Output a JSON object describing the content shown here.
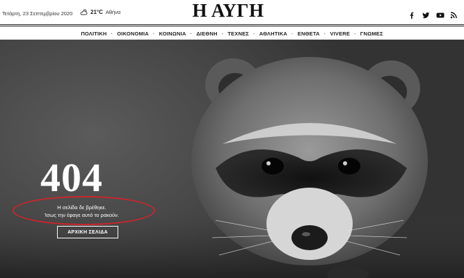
{
  "header": {
    "date": "Τετάρτη, 23 Σεπτεμβρίου 2020",
    "weather": {
      "temperature": "21°C",
      "city": "Αθήνα",
      "icon": "cloud-sun-icon"
    },
    "logo_text": "Η ΑΥΓΗ",
    "social": [
      {
        "name": "facebook-icon"
      },
      {
        "name": "twitter-icon"
      },
      {
        "name": "youtube-icon"
      },
      {
        "name": "rss-icon"
      }
    ]
  },
  "nav": {
    "items": [
      {
        "label": "ΠΟΛΙΤΙΚΗ"
      },
      {
        "label": "ΟΙΚΟΝΟΜΙΑ"
      },
      {
        "label": "ΚΟΙΝΩΝΙΑ"
      },
      {
        "label": "ΔΙΕΘΝΗ"
      },
      {
        "label": "ΤΕΧΝΕΣ"
      },
      {
        "label": "ΑΘΛΗΤΙΚΑ"
      },
      {
        "label": "ΕΝΘΕΤΑ"
      },
      {
        "label": "VIVERE"
      },
      {
        "label": "ΓΝΩΜΕΣ"
      }
    ]
  },
  "error": {
    "code": "404",
    "line1": "Η σελίδα δε βρέθηκε.",
    "line2": "Ίσως την έφαγε αυτό το ρακούν.",
    "home_label": "ΑΡΧΙΚΗ ΣΕΛΙΔΑ"
  },
  "colors": {
    "annotation_ring": "#c9262b",
    "header_text": "#111111",
    "hero_text": "#ffffff"
  }
}
